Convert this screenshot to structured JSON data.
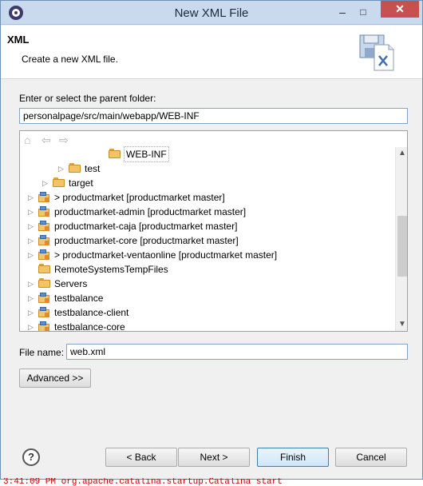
{
  "window": {
    "title": "New XML File",
    "minimize": "‒",
    "maximize": "□",
    "close": "✕"
  },
  "header": {
    "title": "XML",
    "subtitle": "Create a new XML file."
  },
  "parent_folder": {
    "label": "Enter or select the parent folder:",
    "value": "personalpage/src/main/webapp/WEB-INF"
  },
  "tree": {
    "rows": [
      {
        "label": "WEB-INF",
        "icon": "folder-open-icon",
        "expander": ""
      },
      {
        "label": "test",
        "icon": "folder-icon",
        "expander": "▷"
      },
      {
        "label": "target",
        "icon": "folder-icon",
        "expander": "▷"
      },
      {
        "label": "> productmarket  [productmarket master]",
        "icon": "project-icon",
        "expander": "▷"
      },
      {
        "label": "productmarket-admin  [productmarket master]",
        "icon": "project-icon",
        "expander": "▷"
      },
      {
        "label": "productmarket-caja  [productmarket master]",
        "icon": "project-icon",
        "expander": "▷"
      },
      {
        "label": "productmarket-core  [productmarket master]",
        "icon": "project-icon",
        "expander": "▷"
      },
      {
        "label": "> productmarket-ventaonline  [productmarket master]",
        "icon": "project-icon",
        "expander": "▷"
      },
      {
        "label": "RemoteSystemsTempFiles",
        "icon": "folder-icon",
        "expander": ""
      },
      {
        "label": "Servers",
        "icon": "folder-icon",
        "expander": "▷"
      },
      {
        "label": "testbalance",
        "icon": "project-icon",
        "expander": "▷"
      },
      {
        "label": "testbalance-client",
        "icon": "project-icon",
        "expander": "▷"
      },
      {
        "label": "testbalance-core",
        "icon": "project-icon",
        "expander": "▷"
      }
    ]
  },
  "file_name": {
    "label": "File name:",
    "value": "web.xml"
  },
  "buttons": {
    "advanced": "Advanced >>",
    "back": "< Back",
    "next": "Next >",
    "finish": "Finish",
    "cancel": "Cancel"
  },
  "help": "?",
  "console": "3:41:09 PM org.apache.catalina.startup.Catalina start"
}
